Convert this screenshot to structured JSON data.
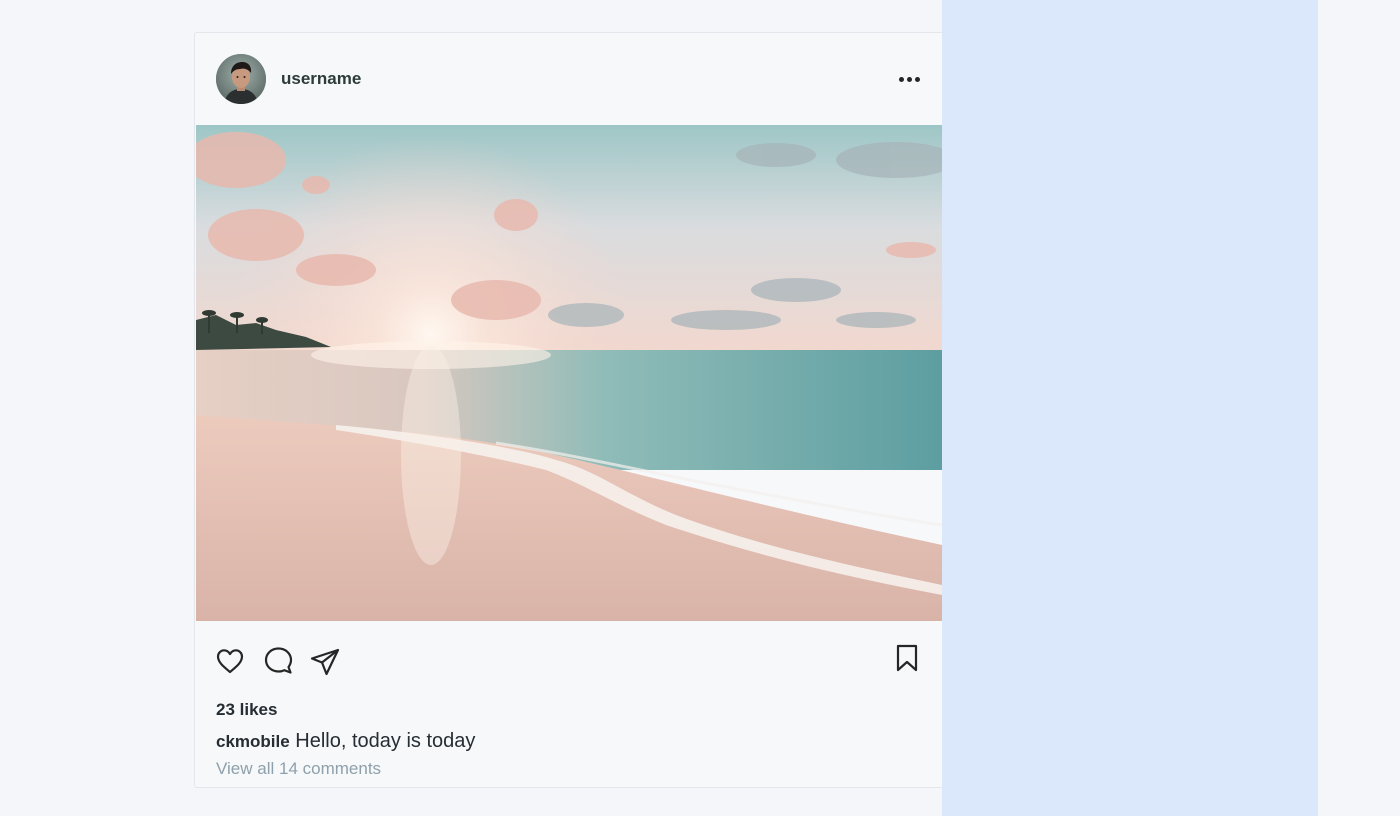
{
  "post": {
    "username": "username",
    "likes_text": "23 likes",
    "caption_user": "ckmobile",
    "caption_text": "Hello, today is today",
    "comments_link": "View all 14 comments"
  },
  "icons": {
    "more": "more-options-icon",
    "like": "heart-icon",
    "comment": "comment-icon",
    "share": "send-icon",
    "save": "bookmark-icon"
  },
  "colors": {
    "page_bg": "#f4f6f9",
    "side_panel": "#dbe8fb",
    "card_bg": "#f7f8fa",
    "text_dark": "#262d33",
    "text_muted": "#8ea0ab"
  }
}
